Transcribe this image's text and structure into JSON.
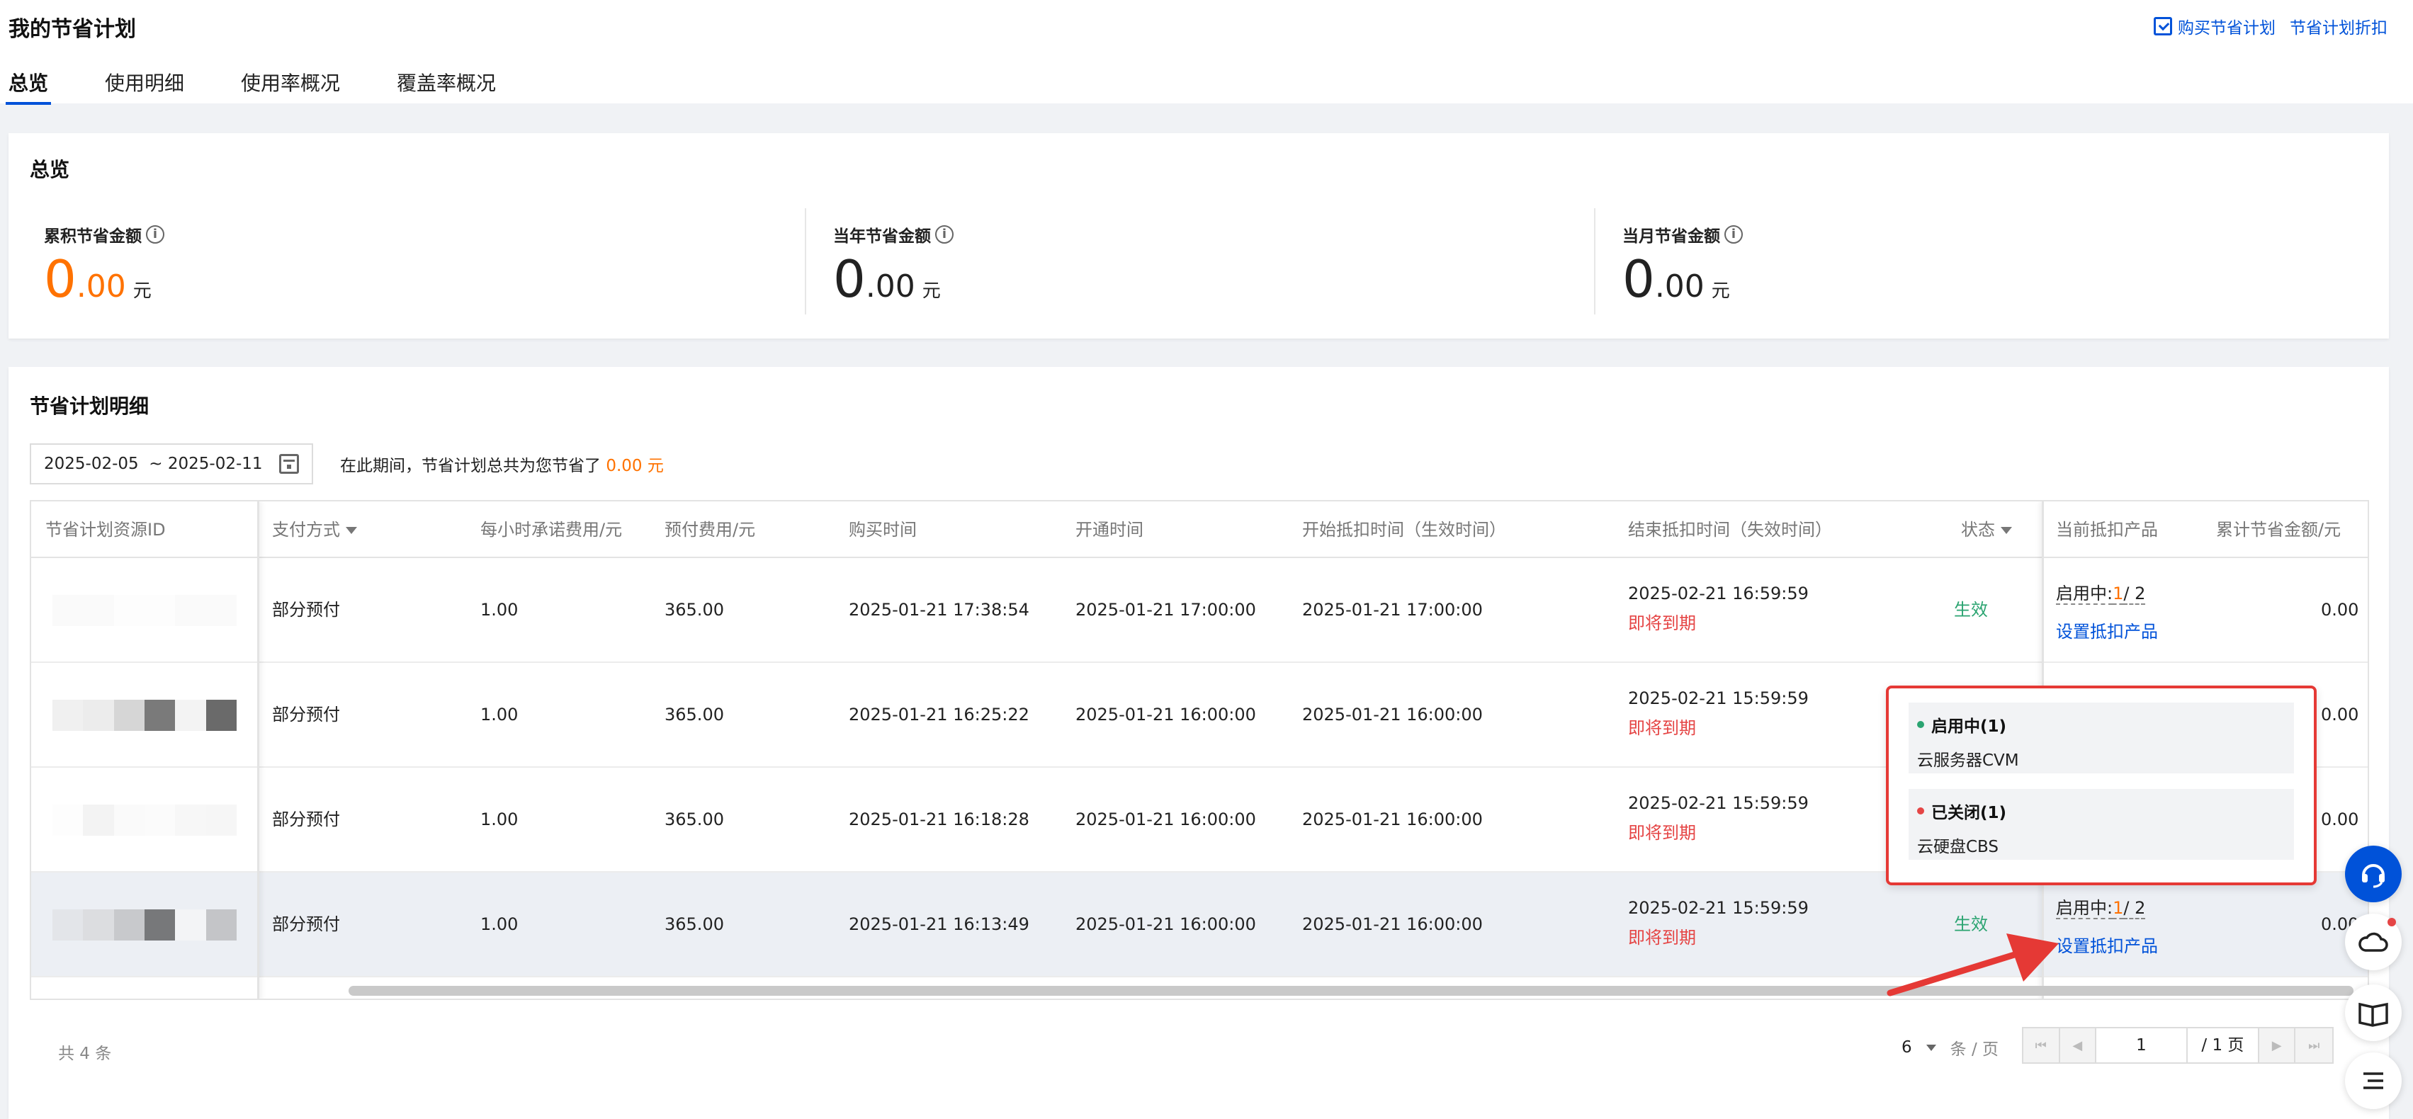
{
  "header": {
    "title": "我的节省计划",
    "buy_link": "购买节省计划",
    "discount_link": "节省计划折扣"
  },
  "tabs": [
    {
      "label": "总览",
      "active": true
    },
    {
      "label": "使用明细",
      "active": false
    },
    {
      "label": "使用率概况",
      "active": false
    },
    {
      "label": "覆盖率概况",
      "active": false
    }
  ],
  "overview": {
    "title": "总览",
    "stats": [
      {
        "label": "累积节省金额",
        "int": "0",
        "dec": ".00",
        "unit": "元"
      },
      {
        "label": "当年节省金额",
        "int": "0",
        "dec": ".00",
        "unit": "元"
      },
      {
        "label": "当月节省金额",
        "int": "0",
        "dec": ".00",
        "unit": "元"
      }
    ]
  },
  "detail": {
    "title": "节省计划明细",
    "date_range": "2025-02-05  ~ 2025-02-11",
    "summary_prefix": "在此期间，节省计划总共为您节省了",
    "summary_value": "0.00 元",
    "columns": {
      "id": "节省计划资源ID",
      "pay": "支付方式",
      "hourly": "每小时承诺费用/元",
      "prepaid": "预付费用/元",
      "buy_time": "购买时间",
      "open_time": "开通时间",
      "start_time": "开始抵扣时间（生效时间）",
      "end_time": "结束抵扣时间（失效时间）",
      "status": "状态",
      "products": "当前抵扣产品",
      "saved": "累计节省金额/元"
    },
    "rows": [
      {
        "pay": "部分预付",
        "hourly": "1.00",
        "prepaid": "365.00",
        "buy_time": "2025-01-21 17:38:54",
        "open_time": "2025-01-21 17:00:00",
        "start_time": "2025-01-21 17:00:00",
        "end_time": "2025-02-21 16:59:59",
        "expiring": "即将到期",
        "status": "生效",
        "prod_label": "启用中:",
        "prod_active": "1",
        "prod_total": "/ 2",
        "prod_link": "设置抵扣产品",
        "saved": "0.00"
      },
      {
        "pay": "部分预付",
        "hourly": "1.00",
        "prepaid": "365.00",
        "buy_time": "2025-01-21 16:25:22",
        "open_time": "2025-01-21 16:00:00",
        "start_time": "2025-01-21 16:00:00",
        "end_time": "2025-02-21 15:59:59",
        "expiring": "即将到期",
        "status": "",
        "prod_label": "",
        "prod_active": "",
        "prod_total": "",
        "prod_link": "",
        "saved": "0.00"
      },
      {
        "pay": "部分预付",
        "hourly": "1.00",
        "prepaid": "365.00",
        "buy_time": "2025-01-21 16:18:28",
        "open_time": "2025-01-21 16:00:00",
        "start_time": "2025-01-21 16:00:00",
        "end_time": "2025-02-21 15:59:59",
        "expiring": "即将到期",
        "status": "",
        "prod_label": "",
        "prod_active": "",
        "prod_total": "",
        "prod_link": "",
        "saved": "0.00"
      },
      {
        "pay": "部分预付",
        "hourly": "1.00",
        "prepaid": "365.00",
        "buy_time": "2025-01-21 16:13:49",
        "open_time": "2025-01-21 16:00:00",
        "start_time": "2025-01-21 16:00:00",
        "end_time": "2025-02-21 15:59:59",
        "expiring": "即将到期",
        "status": "生效",
        "prod_label": "启用中:",
        "prod_active": "1",
        "prod_total": "/ 2",
        "prod_link": "设置抵扣产品",
        "saved": "0.00"
      }
    ],
    "total": "共 4 条",
    "page_size": "6",
    "page_size_unit": "条 / 页",
    "page_current": "1",
    "page_total": "/ 1 页"
  },
  "popover": {
    "active_head": "启用中(1)",
    "active_product": "云服务器CVM",
    "closed_head": "已关闭(1)",
    "closed_product": "云硬盘CBS"
  },
  "colors": {
    "accent": "#0052d9",
    "orange": "#ff7200",
    "success": "#2ba471",
    "danger": "#e54545"
  }
}
